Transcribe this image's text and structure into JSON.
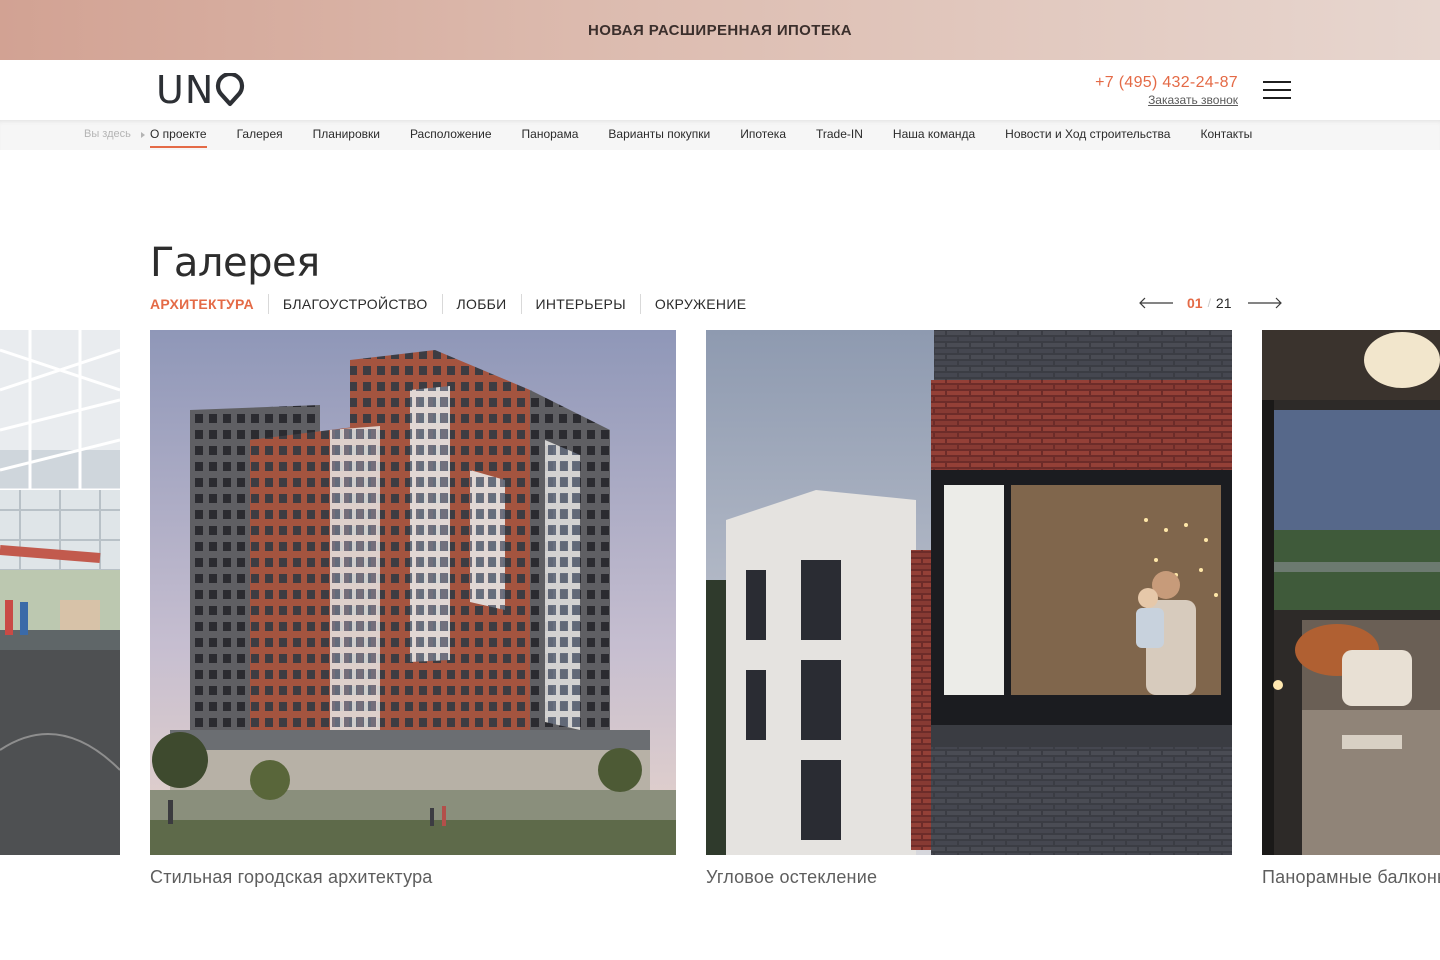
{
  "promo": {
    "text": "НОВАЯ РАСШИРЕННАЯ ИПОТЕКА"
  },
  "header": {
    "logo_text": "UN",
    "phone": "+7 (495) 432-24-87",
    "callback": "Заказать звонок"
  },
  "subnav": {
    "here_label": "Вы здесь",
    "items": [
      {
        "label": "О проекте"
      },
      {
        "label": "Галерея"
      },
      {
        "label": "Планировки"
      },
      {
        "label": "Расположение"
      },
      {
        "label": "Панорама"
      },
      {
        "label": "Варианты покупки"
      },
      {
        "label": "Ипотека"
      },
      {
        "label": "Trade-IN"
      },
      {
        "label": "Наша команда"
      },
      {
        "label": "Новости и Ход строительства"
      },
      {
        "label": "Контакты"
      }
    ],
    "active_index": 0
  },
  "gallery": {
    "title": "Галерея",
    "tabs": [
      {
        "label": "Архитектура"
      },
      {
        "label": "Благоустройство"
      },
      {
        "label": "Лобби"
      },
      {
        "label": "Интерьеры"
      },
      {
        "label": "Окружение"
      }
    ],
    "active_tab": 0,
    "pager": {
      "current": "01",
      "separator": "/",
      "total": "21"
    },
    "slides": [
      {
        "caption": ""
      },
      {
        "caption": "Стильная городская архитектура"
      },
      {
        "caption": "Угловое остекление"
      },
      {
        "caption": "Панорамные балконы"
      }
    ]
  },
  "colors": {
    "accent": "#e46a46",
    "text": "#2b2b2b",
    "caption": "#5e5e5e"
  }
}
